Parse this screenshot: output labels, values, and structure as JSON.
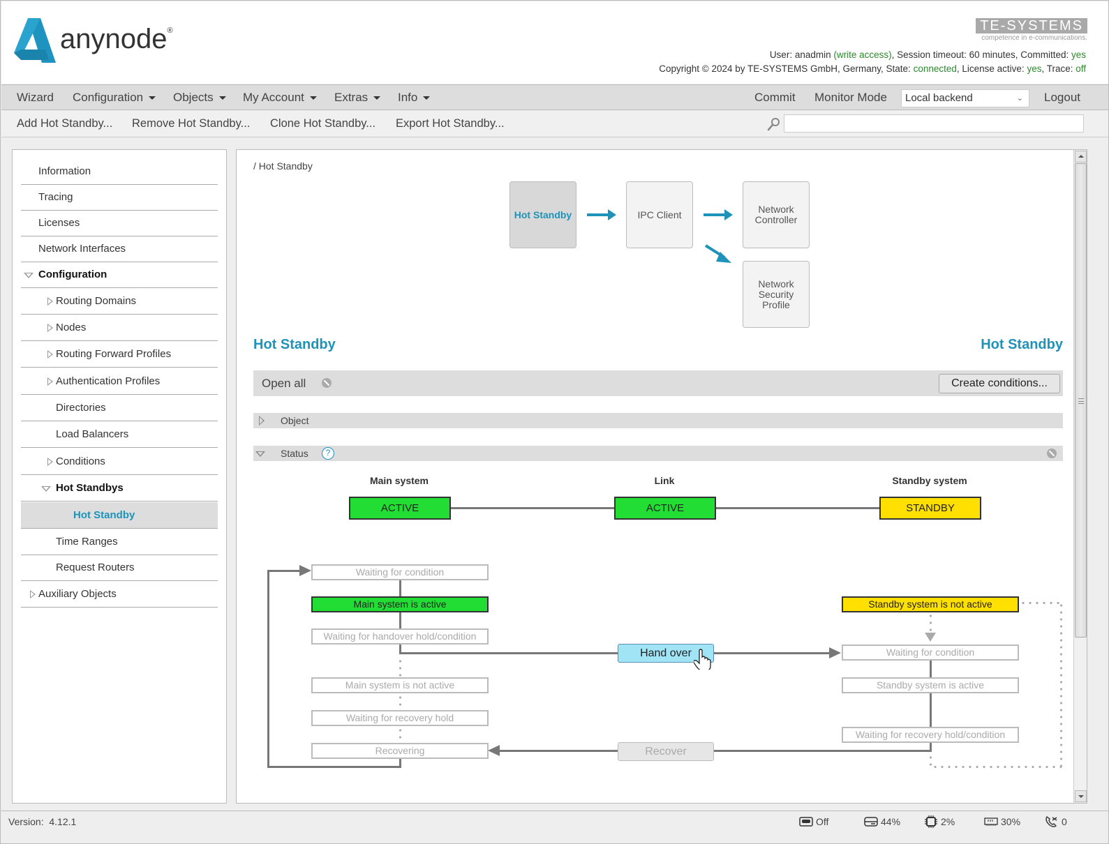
{
  "header": {
    "logo_text_bold": "any",
    "logo_text_light": "node",
    "logo_reg": "®",
    "brand_name": "TE-SYSTEMS",
    "brand_tagline": "competence in e-communications.",
    "user_prefix": "User: anadmin ",
    "user_access": "(write access)",
    "session_text": ", Session timeout: 60 minutes, Committed: ",
    "committed_value": "yes",
    "copyright_text": "Copyright © 2024 by TE-SYSTEMS GmbH, Germany, State: ",
    "state_value": "connected",
    "license_text": ", License active: ",
    "license_value": "yes",
    "trace_text": ", Trace: ",
    "trace_value": "off"
  },
  "menubar": {
    "items": [
      {
        "label": "Wizard",
        "dropdown": false
      },
      {
        "label": "Configuration",
        "dropdown": true
      },
      {
        "label": "Objects",
        "dropdown": true
      },
      {
        "label": "My Account",
        "dropdown": true
      },
      {
        "label": "Extras",
        "dropdown": true
      },
      {
        "label": "Info",
        "dropdown": true
      }
    ],
    "commit_label": "Commit",
    "monitor_label": "Monitor Mode",
    "backend_selected": "Local backend",
    "logout_label": "Logout"
  },
  "toolbar": {
    "add_label": "Add Hot Standby...",
    "remove_label": "Remove Hot Standby...",
    "clone_label": "Clone Hot Standby...",
    "export_label": "Export Hot Standby...",
    "search_value": ""
  },
  "sidebar": {
    "items": [
      {
        "label": "Information",
        "level": 0,
        "toggle": "none"
      },
      {
        "label": "Tracing",
        "level": 0,
        "toggle": "none"
      },
      {
        "label": "Licenses",
        "level": 0,
        "toggle": "none"
      },
      {
        "label": "Network Interfaces",
        "level": 0,
        "toggle": "none"
      },
      {
        "label": "Configuration",
        "level": 0,
        "toggle": "expanded"
      },
      {
        "label": "Routing Domains",
        "level": 1,
        "toggle": "collapsed"
      },
      {
        "label": "Nodes",
        "level": 1,
        "toggle": "collapsed"
      },
      {
        "label": "Routing Forward Profiles",
        "level": 1,
        "toggle": "collapsed"
      },
      {
        "label": "Authentication Profiles",
        "level": 1,
        "toggle": "collapsed"
      },
      {
        "label": "Directories",
        "level": 1,
        "toggle": "none"
      },
      {
        "label": "Load Balancers",
        "level": 1,
        "toggle": "none"
      },
      {
        "label": "Conditions",
        "level": 1,
        "toggle": "collapsed"
      },
      {
        "label": "Hot Standbys",
        "level": 1,
        "toggle": "expanded"
      },
      {
        "label": "Hot Standby",
        "level": 2,
        "toggle": "none",
        "selected": true
      },
      {
        "label": "Time Ranges",
        "level": 1,
        "toggle": "none"
      },
      {
        "label": "Request Routers",
        "level": 1,
        "toggle": "none"
      },
      {
        "label": "Auxiliary Objects",
        "level": 0,
        "toggle": "collapsed"
      }
    ]
  },
  "main": {
    "breadcrumb": "/ Hot Standby",
    "flow": {
      "current": "Hot Standby",
      "ipc_client": "IPC Client",
      "network_controller": "Network Controller",
      "network_security_profile": "Network Security Profile"
    },
    "title_left": "Hot Standby",
    "title_right": "Hot Standby",
    "open_all_label": "Open all",
    "create_conditions_label": "Create conditions...",
    "sections": {
      "object_label": "Object",
      "status_label": "Status",
      "help_glyph": "?"
    },
    "status": {
      "main_system_label": "Main system",
      "link_label": "Link",
      "standby_system_label": "Standby system",
      "main_state": "ACTIVE",
      "link_state": "ACTIVE",
      "standby_state": "STANDBY",
      "colors": {
        "active": "#22dd33",
        "standby": "#ffe000",
        "inactive_border": "#bbbbbb",
        "button": "#a0e4f6"
      },
      "main_states": [
        {
          "label": "Waiting for condition",
          "active": false
        },
        {
          "label": "Main system is active",
          "active": true
        },
        {
          "label": "Waiting for handover hold/condition",
          "active": false
        },
        {
          "label": "Main system is not active",
          "active": false
        },
        {
          "label": "Waiting for recovery hold",
          "active": false
        },
        {
          "label": "Recovering",
          "active": false
        }
      ],
      "standby_states": [
        {
          "label": "Standby system is not active",
          "active": true
        },
        {
          "label": "Waiting for condition",
          "active": false
        },
        {
          "label": "Standby system is active",
          "active": false
        },
        {
          "label": "Waiting for recovery hold/condition",
          "active": false
        }
      ],
      "hand_over_label": "Hand over",
      "recover_label": "Recover"
    }
  },
  "footer": {
    "version_label": "Version:",
    "version_value": "4.12.1",
    "recording": "Off",
    "disk": "44%",
    "cpu": "2%",
    "memory": "30%",
    "calls": "0"
  }
}
